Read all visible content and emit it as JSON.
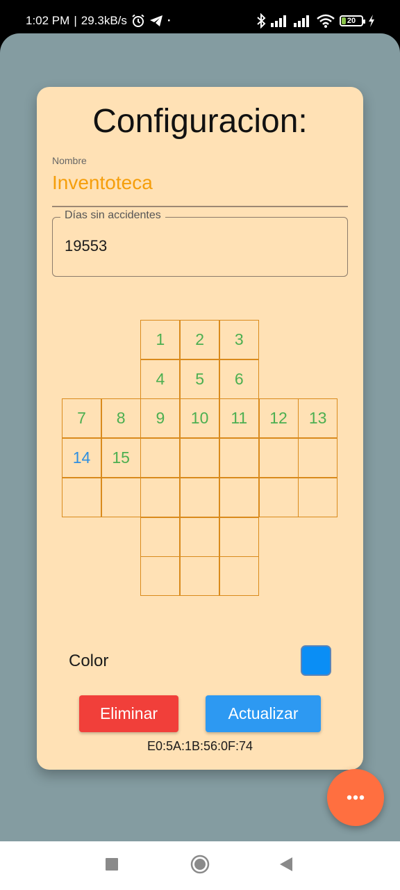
{
  "status_bar": {
    "time": "1:02 PM",
    "separator": "|",
    "network_speed": "29.3kB/s",
    "dot": "·",
    "battery_level": "20",
    "icons": [
      "alarm-icon",
      "telegram-icon",
      "bluetooth-icon",
      "signal-icon",
      "signal-icon",
      "wifi-icon",
      "battery-icon",
      "charging-icon"
    ]
  },
  "config": {
    "title": "Configuracion:",
    "name_field": {
      "label": "Nombre",
      "value": "Inventoteca"
    },
    "days_field": {
      "label": "Días sin accidentes",
      "value": "19553"
    },
    "grid": [
      [
        "",
        "",
        "1",
        "2",
        "3",
        "",
        ""
      ],
      [
        "",
        "",
        "4",
        "5",
        "6",
        "",
        ""
      ],
      [
        "7",
        "8",
        "9",
        "10",
        "11",
        "12",
        "13"
      ],
      [
        "14",
        "15",
        "",
        "",
        "",
        "",
        ""
      ],
      [
        "",
        "",
        "",
        "",
        "",
        "",
        ""
      ],
      [
        "",
        "",
        "",
        "",
        "",
        "",
        ""
      ],
      [
        "",
        "",
        "",
        "",
        "",
        "",
        ""
      ]
    ],
    "color": {
      "label": "Color",
      "value": "#0a8ef5"
    },
    "buttons": {
      "delete_label": "Eliminar",
      "update_label": "Actualizar"
    },
    "mac_address": "E0:5A:1B:56:0F:74"
  },
  "fab": {
    "icon": "more-horizontal-icon"
  },
  "nav_bar": {
    "icons": [
      "recents-square-icon",
      "home-circle-icon",
      "back-triangle-icon"
    ]
  },
  "colors": {
    "accent_orange": "#f59e0b",
    "card_background": "#ffe1b5",
    "page_background": "#849ca1",
    "cell_number_green": "#4caf50",
    "cell_number_blue": "#2f8fe0",
    "delete_red": "#f13f3a",
    "update_blue": "#2d99f2",
    "fab_orange": "#ff6f40"
  }
}
